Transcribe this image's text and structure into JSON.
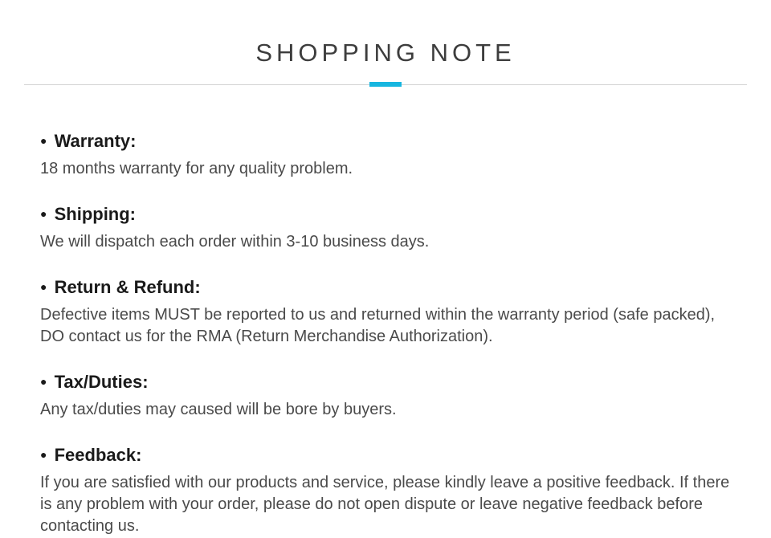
{
  "page": {
    "title": "SHOPPING NOTE"
  },
  "sections": [
    {
      "heading": "Warranty:",
      "body": "18 months warranty for any quality problem."
    },
    {
      "heading": "Shipping:",
      "body": "We will dispatch each order within 3-10 business days."
    },
    {
      "heading": "Return & Refund:",
      "body": "Defective items MUST be reported to us and  returned within the warranty period (safe packed), DO contact us for the RMA (Return Merchandise Authorization)."
    },
    {
      "heading": "Tax/Duties:",
      "body": "Any tax/duties may caused will be bore by buyers."
    },
    {
      "heading": "Feedback:",
      "body": "If you are satisfied with our products and service, please kindly leave a positive feedback. If there is any problem with your order, please do not open dispute or leave negative feedback before contacting us."
    }
  ]
}
